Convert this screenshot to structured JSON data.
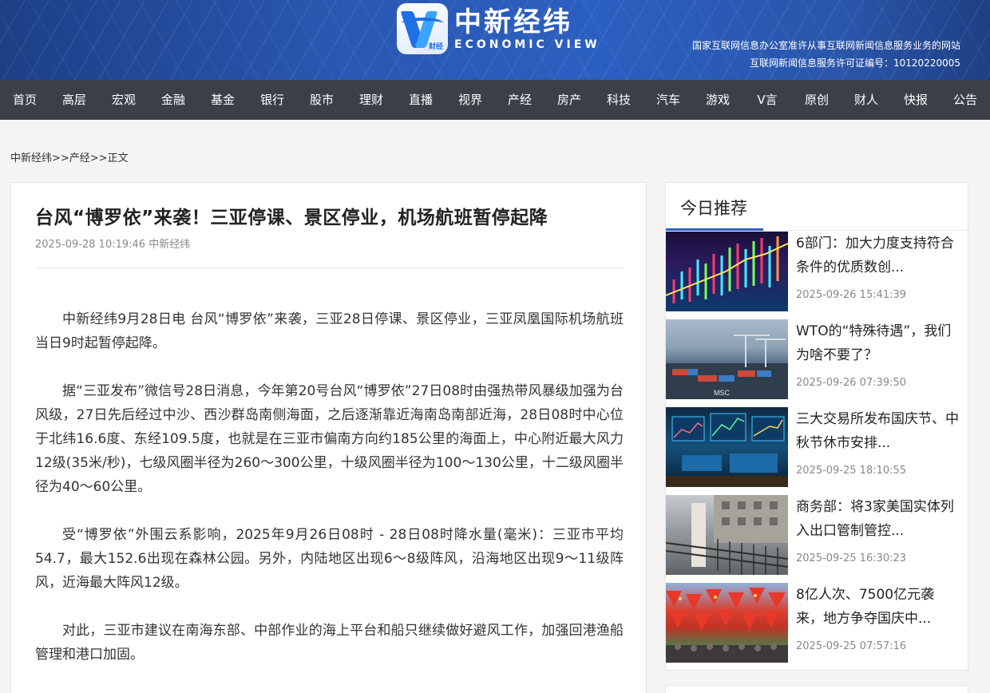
{
  "header": {
    "logo_cn": "中新经纬",
    "logo_en": "ECONOMIC VIEW",
    "logo_tag": "财经",
    "license_line1": "国家互联网信息办公室准许从事互联网新闻信息服务业务的网站",
    "license_line2": "互联网新闻信息服务许可证编号：10120220005"
  },
  "nav": [
    "首页",
    "高层",
    "宏观",
    "金融",
    "基金",
    "银行",
    "股市",
    "理财",
    "直播",
    "视界",
    "产经",
    "房产",
    "科技",
    "汽车",
    "游戏",
    "V言",
    "原创",
    "财人",
    "快报",
    "公告"
  ],
  "breadcrumb": "中新经纬>>产经>>正文",
  "article": {
    "title": "台风“博罗依”来袭！三亚停课、景区停业，机场航班暂停起降",
    "meta": "2025-09-28 10:19:46 中新经纬",
    "paragraphs": [
      "中新经纬9月28日电 台风“博罗依”来袭，三亚28日停课、景区停业，三亚凤凰国际机场航班当日9时起暂停起降。",
      "据“三亚发布”微信号28日消息，今年第20号台风“博罗依”27日08时由强热带风暴级加强为台风级，27日先后经过中沙、西沙群岛南侧海面，之后逐渐靠近海南岛南部近海，28日08时中心位于北纬16.6度、东经109.5度，也就是在三亚市偏南方向约185公里的海面上，中心附近最大风力12级(35米/秒)，七级风圈半径为260～300公里，十级风圈半径为100～130公里，十二级风圈半径为40～60公里。",
      "受“博罗依”外围云系影响，2025年9月26日08时 - 28日08时降水量(毫米)：三亚市平均54.7，最大152.6出现在森林公园。另外，内陆地区出现6～8级阵风，沿海地区出现9～11级阵风，近海最大阵风12级。",
      "对此，三亚市建议在南海东部、中部作业的海上平台和船只继续做好避风工作，加强回港渔船管理和港口加固。"
    ]
  },
  "sidebar": {
    "heading": "今日推荐",
    "items": [
      {
        "title": "6部门：加大力度支持符合条件的优质数创...",
        "time": "2025-09-26 15:41:39"
      },
      {
        "title": "WTO的“特殊待遇”，我们为啥不要了？",
        "time": "2025-09-26 07:39:50"
      },
      {
        "title": "三大交易所发布国庆节、中秋节休市安排...",
        "time": "2025-09-25 18:10:55"
      },
      {
        "title": "商务部：将3家美国实体列入出口管制管控...",
        "time": "2025-09-25 16:30:23"
      },
      {
        "title": "8亿人次、7500亿元袭来，地方争夺国庆中...",
        "time": "2025-09-25 07:57:16"
      }
    ]
  },
  "colors": {
    "nav_bg": "#3a3f48",
    "banner_blue": "#2b5fc0",
    "accent": "#2a5fc1"
  }
}
